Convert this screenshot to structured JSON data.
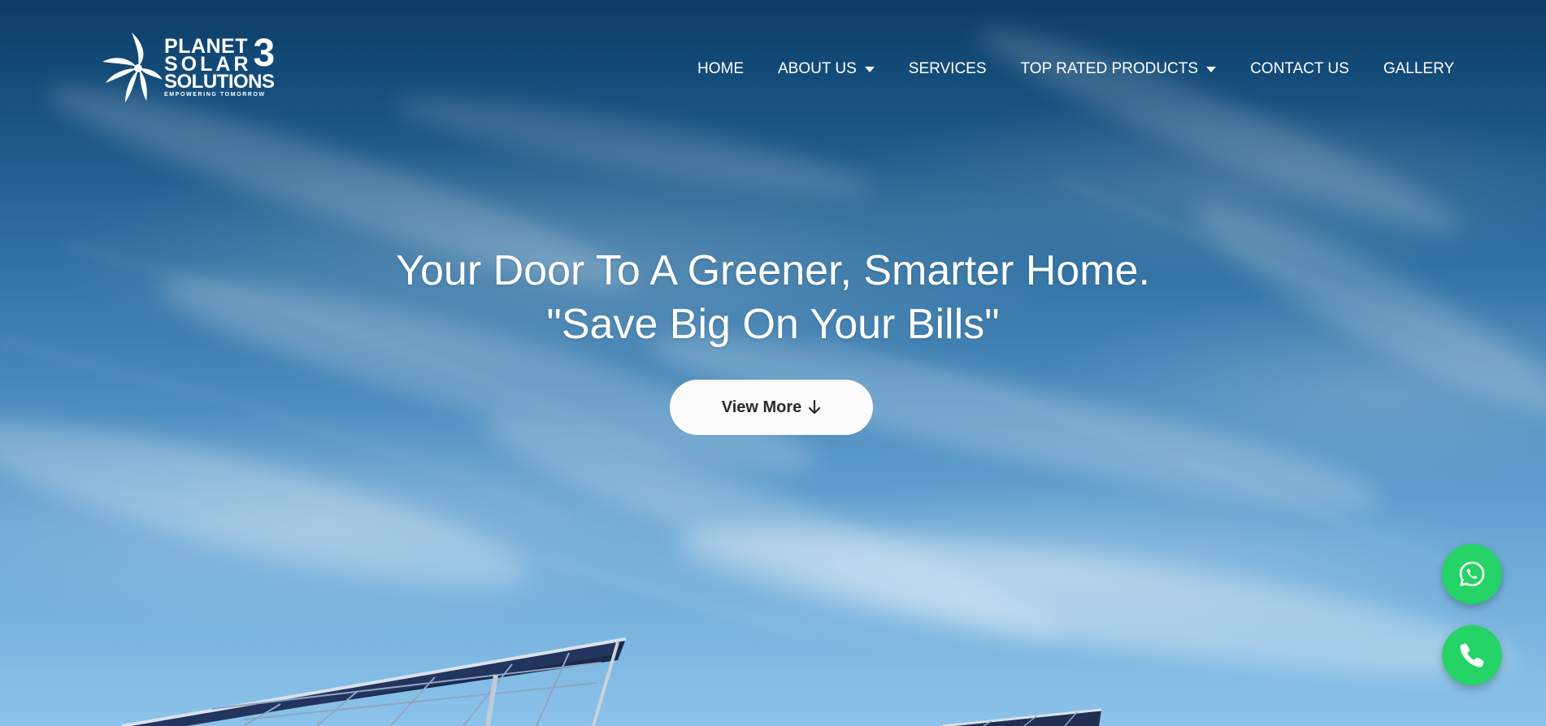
{
  "logo": {
    "line1": "PLANET",
    "line2": "SOLAR",
    "line3": "SOLUTIONS",
    "number": "3",
    "tagline": "EMPOWERING TOMORROW"
  },
  "nav": {
    "items": [
      {
        "label": "HOME",
        "dropdown": false
      },
      {
        "label": "ABOUT US",
        "dropdown": true
      },
      {
        "label": "SERVICES",
        "dropdown": false
      },
      {
        "label": "TOP RATED PRODUCTS",
        "dropdown": true
      },
      {
        "label": "CONTACT US",
        "dropdown": false
      },
      {
        "label": "GALLERY",
        "dropdown": false
      }
    ]
  },
  "hero": {
    "headline_line1": "Your Door To A Greener, Smarter Home.",
    "headline_line2": "\"Save Big On Your Bills\"",
    "cta_label": "View More",
    "cta_icon": "arrow-down-icon"
  },
  "floating": {
    "whatsapp_icon": "whatsapp-icon",
    "phone_icon": "phone-icon"
  },
  "colors": {
    "sky_top": "#0b3d66",
    "sky_bottom": "#8cc3ea",
    "cta_bg": "#fbfcfb",
    "fab_green": "#25d366"
  }
}
